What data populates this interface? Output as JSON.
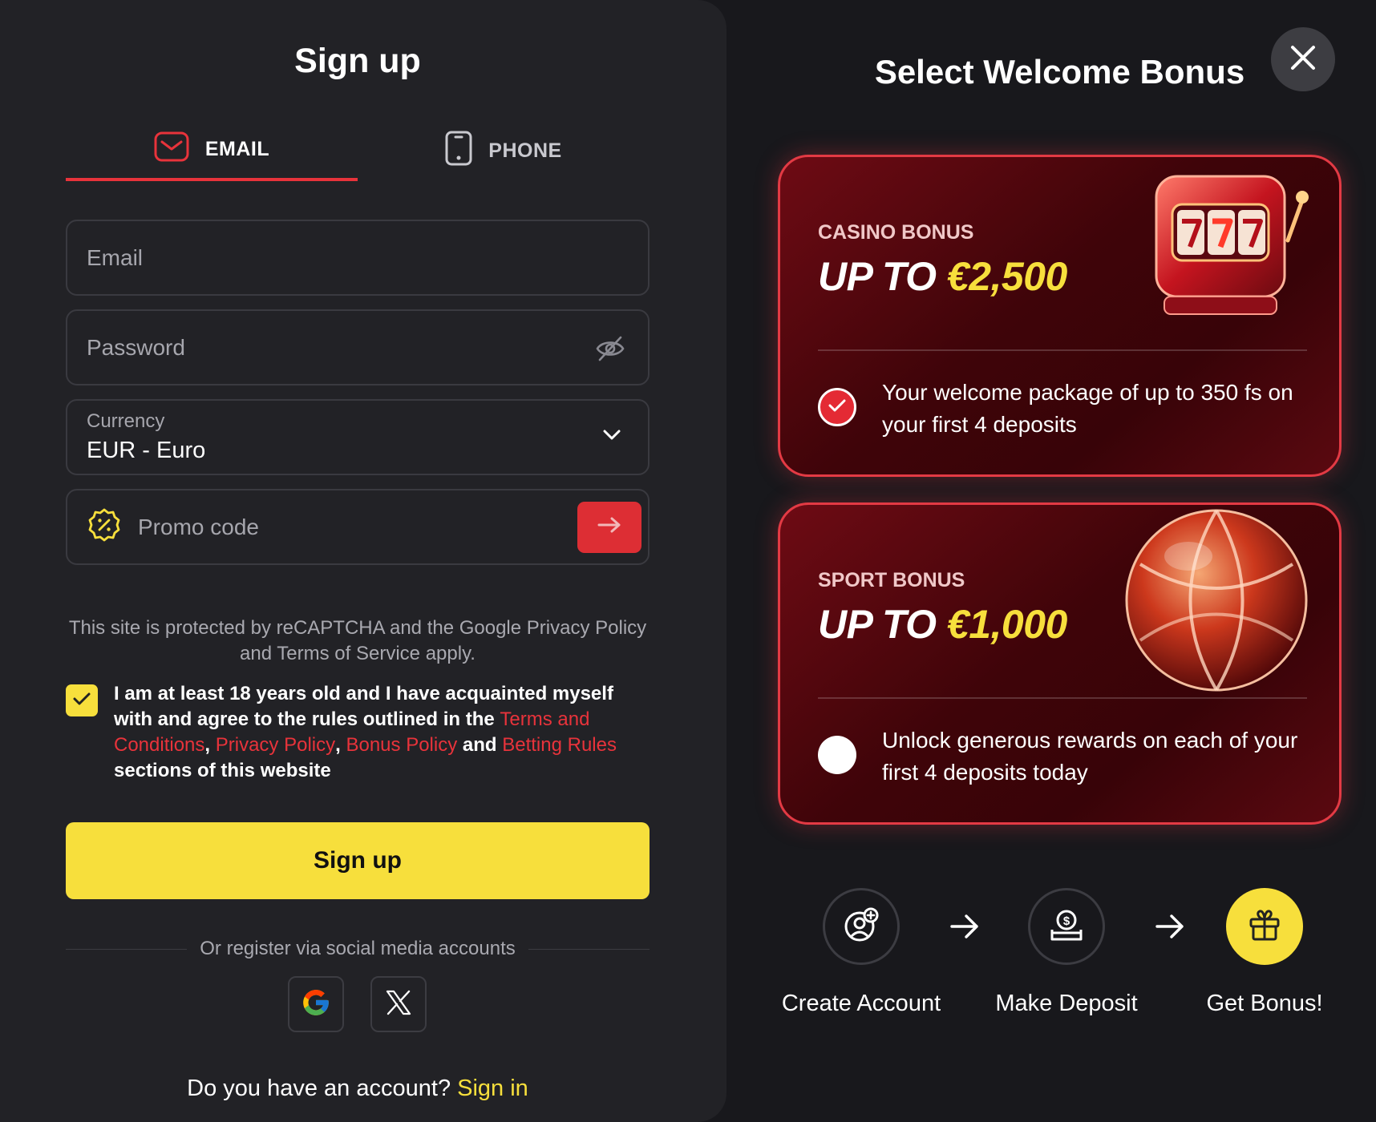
{
  "signup": {
    "title": "Sign up",
    "tabs": {
      "email": "EMAIL",
      "phone": "PHONE"
    },
    "email_placeholder": "Email",
    "password_placeholder": "Password",
    "currency": {
      "label": "Currency",
      "value": "EUR - Euro"
    },
    "promo_placeholder": "Promo code",
    "captcha_text": "This site is protected by reCAPTCHA and the Google Privacy Policy and Terms of Service apply.",
    "agree": {
      "checked": true,
      "part1": "I am at least 18 years old and I have acquainted myself with and agree to the rules outlined in the ",
      "link_terms": "Terms and Conditions",
      "sep1": ", ",
      "link_privacy": "Privacy Policy",
      "sep2": ", ",
      "link_bonus": "Bonus Policy",
      "sep3": " and ",
      "link_betting": "Betting Rules",
      "part2": " sections of this website"
    },
    "submit_label": "Sign up",
    "social_text": "Or register via social media accounts",
    "have_account": "Do you have an account? ",
    "sign_in": "Sign in"
  },
  "bonus": {
    "title": "Select Welcome Bonus",
    "cards": [
      {
        "label": "CASINO BONUS",
        "amount_prefix": "UP TO ",
        "amount": "€2,500",
        "description": "Your welcome package of up to 350 fs on your first 4 deposits",
        "selected": true,
        "art_icon": "slot-machine-icon"
      },
      {
        "label": "SPORT BONUS",
        "amount_prefix": "UP TO ",
        "amount": "€1,000",
        "description": "Unlock generous rewards on each of your first 4 deposits today",
        "selected": false,
        "art_icon": "basketball-icon"
      }
    ],
    "steps": [
      {
        "label": "Create Account",
        "icon": "create-account-icon"
      },
      {
        "label": "Make Deposit",
        "icon": "deposit-icon"
      },
      {
        "label": "Get Bonus!",
        "icon": "gift-icon"
      }
    ]
  },
  "colors": {
    "accent_red": "#e8333b",
    "accent_yellow": "#f7df3c",
    "panel_bg": "#222226",
    "page_bg": "#18181c"
  }
}
